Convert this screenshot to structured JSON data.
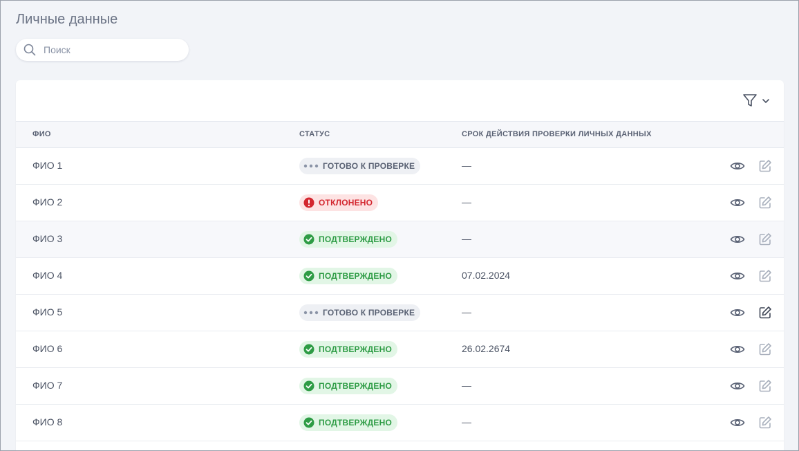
{
  "page": {
    "title": "Личные данные"
  },
  "search": {
    "placeholder": "Поиск",
    "value": ""
  },
  "columns": {
    "name": "ФИО",
    "status": "СТАТУС",
    "expiry": "СРОК ДЕЙСТВИЯ ПРОВЕРКИ ЛИЧНЫХ ДАННЫХ"
  },
  "colors": {
    "ready_bg": "#eef0f4",
    "rejected_bg": "#fde3e3",
    "rejected_fg": "#d3262e",
    "approved_bg": "#e2f6e6",
    "approved_fg": "#2e9c45"
  },
  "rows": [
    {
      "name": "ФИО 1",
      "status": "ГОТОВО К ПРОВЕРКЕ",
      "status_type": "ready",
      "expiry": "—",
      "edit_active": false
    },
    {
      "name": "ФИО 2",
      "status": "ОТКЛОНЕНО",
      "status_type": "rejected",
      "expiry": "—",
      "edit_active": false
    },
    {
      "name": "ФИО 3",
      "status": "ПОДТВЕРЖДЕНО",
      "status_type": "approved",
      "expiry": "—",
      "edit_active": false
    },
    {
      "name": "ФИО 4",
      "status": "ПОДТВЕРЖДЕНО",
      "status_type": "approved",
      "expiry": "07.02.2024",
      "edit_active": false
    },
    {
      "name": "ФИО 5",
      "status": "ГОТОВО К ПРОВЕРКЕ",
      "status_type": "ready",
      "expiry": "—",
      "edit_active": true
    },
    {
      "name": "ФИО 6",
      "status": "ПОДТВЕРЖДЕНО",
      "status_type": "approved",
      "expiry": "26.02.2674",
      "edit_active": false
    },
    {
      "name": "ФИО 7",
      "status": "ПОДТВЕРЖДЕНО",
      "status_type": "approved",
      "expiry": "—",
      "edit_active": false
    },
    {
      "name": "ФИО 8",
      "status": "ПОДТВЕРЖДЕНО",
      "status_type": "approved",
      "expiry": "—",
      "edit_active": false
    }
  ],
  "icons": {
    "search": "search-icon",
    "filter": "filter-icon",
    "chevron": "chevron-down-icon",
    "view": "eye-icon",
    "edit": "edit-icon"
  }
}
